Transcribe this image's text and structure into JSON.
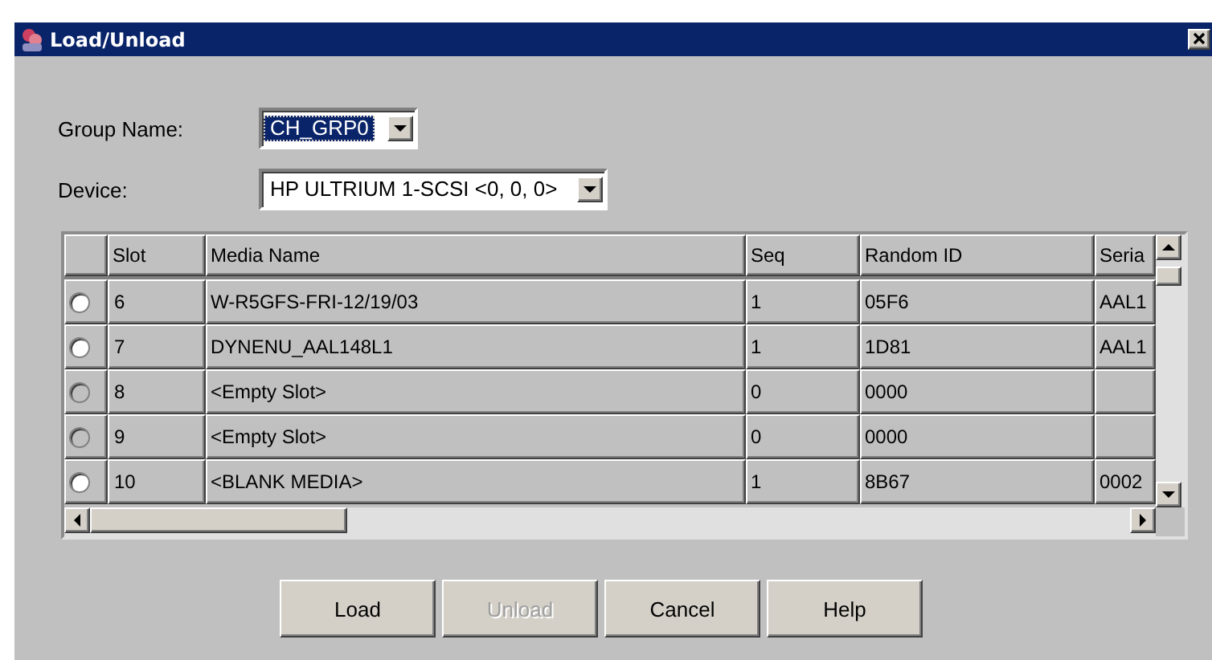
{
  "window": {
    "title": "Load/Unload"
  },
  "fields": [
    {
      "label": "Group Name:",
      "value": "CH_GRP0",
      "focused": true
    },
    {
      "label": "Device:",
      "value": "HP ULTRIUM 1-SCSI <0, 0, 0>",
      "focused": false
    }
  ],
  "table": {
    "columns": [
      "Slot",
      "Media Name",
      "Seq",
      "Random ID",
      "Seria"
    ],
    "rows": [
      {
        "selected": false,
        "disabled": false,
        "cells": [
          "6",
          "W-R5GFS-FRI-12/19/03",
          "1",
          "05F6",
          "AAL1"
        ]
      },
      {
        "selected": false,
        "disabled": false,
        "cells": [
          "7",
          "DYNENU_AAL148L1",
          "1",
          "1D81",
          "AAL1"
        ]
      },
      {
        "selected": false,
        "disabled": true,
        "cells": [
          "8",
          "<Empty Slot>",
          "0",
          "0000"
        ]
      },
      {
        "selected": false,
        "disabled": true,
        "cells": [
          "9",
          "<Empty Slot>",
          "0",
          "0000"
        ]
      },
      {
        "selected": false,
        "disabled": false,
        "cells": [
          "10",
          "<BLANK MEDIA>",
          "1",
          "8B67",
          "0002"
        ]
      }
    ]
  },
  "buttons": [
    {
      "label": "Load",
      "disabled": false
    },
    {
      "label": "Unload",
      "disabled": true
    },
    {
      "label": "Cancel",
      "disabled": false
    },
    {
      "label": "Help",
      "disabled": false
    }
  ]
}
